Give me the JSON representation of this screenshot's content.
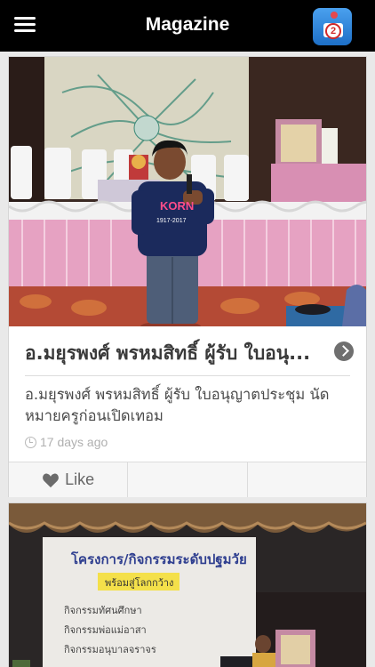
{
  "header": {
    "title": "Magazine",
    "camera_badge": "2",
    "menu_icon": "hamburger-menu-icon",
    "camera_icon": "camera-app-icon"
  },
  "articles": [
    {
      "headline": "อ.มยุรพงศ์ พรหมสิทธิ์ ผู้รับ ใบอนุ...",
      "summary": "อ.มยุรพงศ์ พรหมสิทธิ์ ผู้รับ ใบอนุญาตประชุม นัดหมายครูก่อนเปิดเทอม",
      "time": "17 days ago",
      "like_label": "Like",
      "shirt_text": "KORN",
      "shirt_years": "1917-2017"
    },
    {
      "poster_title": "โครงการ/กิจกรรมระดับปฐมวัย",
      "poster_sub": "พร้อมสู่โลกกว้าง",
      "poster_items": [
        "กิจกรรมทัศนศึกษา",
        "กิจกรรมพ่อแม่อาสา",
        "กิจกรรมอนุบาลจราจร"
      ]
    }
  ],
  "colors": {
    "topbar": "#000000",
    "accent_blue": "#2a7fd6",
    "stage_pink": "#e9a6c4"
  }
}
